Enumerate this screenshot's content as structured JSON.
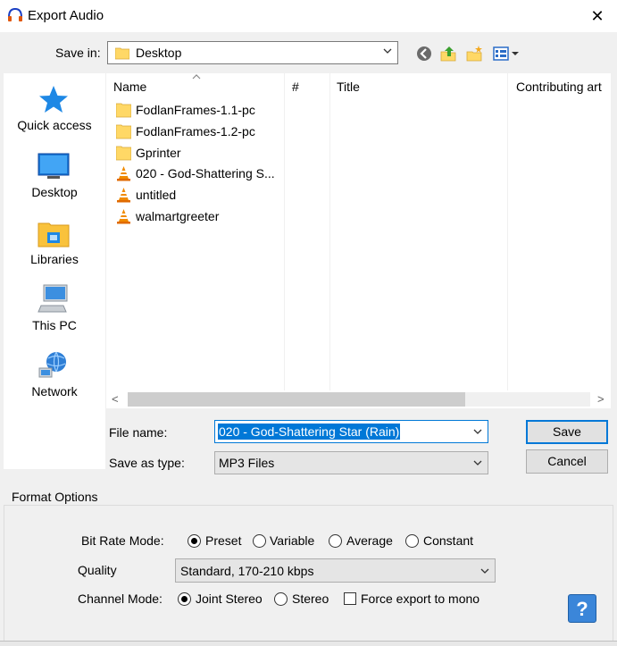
{
  "window": {
    "title": "Export Audio",
    "close_glyph": "✕"
  },
  "save_in": {
    "label": "Save in:",
    "value": "Desktop"
  },
  "toolbar_icons": [
    "back-icon",
    "up-folder-icon",
    "new-folder-icon",
    "view-menu-icon"
  ],
  "places": [
    {
      "label": "Quick access",
      "icon": "star-icon"
    },
    {
      "label": "Desktop",
      "icon": "desktop-icon"
    },
    {
      "label": "Libraries",
      "icon": "libraries-icon"
    },
    {
      "label": "This PC",
      "icon": "computer-icon"
    },
    {
      "label": "Network",
      "icon": "network-icon"
    }
  ],
  "columns": [
    "Name",
    "#",
    "Title",
    "Contributing art"
  ],
  "files": [
    {
      "name": "FodlanFrames-1.1-pc",
      "type": "folder"
    },
    {
      "name": "FodlanFrames-1.2-pc",
      "type": "folder"
    },
    {
      "name": "Gprinter",
      "type": "folder"
    },
    {
      "name": "020 - God-Shattering S...",
      "type": "vlc"
    },
    {
      "name": "untitled",
      "type": "vlc"
    },
    {
      "name": "walmartgreeter",
      "type": "vlc"
    }
  ],
  "file_name": {
    "label": "File name:",
    "value": "020 - God-Shattering Star (Rain)"
  },
  "save_as_type": {
    "label": "Save as type:",
    "value": "MP3 Files"
  },
  "buttons": {
    "save": "Save",
    "cancel": "Cancel",
    "help": "?"
  },
  "format_options": {
    "title": "Format Options",
    "bit_rate_mode": {
      "label": "Bit Rate Mode:",
      "options": [
        "Preset",
        "Variable",
        "Average",
        "Constant"
      ],
      "selected": "Preset"
    },
    "quality": {
      "label": "Quality",
      "value": "Standard, 170-210 kbps"
    },
    "channel_mode": {
      "label": "Channel Mode:",
      "options": [
        "Joint Stereo",
        "Stereo"
      ],
      "selected": "Joint Stereo",
      "force_mono_label": "Force export to mono",
      "force_mono": false
    }
  },
  "colors": {
    "accent": "#0078d7",
    "folder": "#ffd866",
    "vlc_orange": "#f08a00",
    "help_blue": "#3b86d9"
  }
}
